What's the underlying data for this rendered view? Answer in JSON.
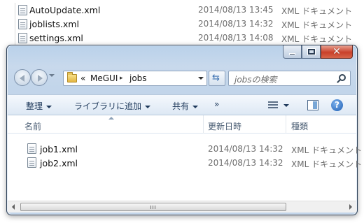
{
  "background_list": [
    {
      "name": "AutoUpdate.xml",
      "date": "2014/08/13 13:45",
      "type": "XML ドキュメント"
    },
    {
      "name": "joblists.xml",
      "date": "2014/08/13 14:32",
      "type": "XML ドキュメント"
    },
    {
      "name": "settings.xml",
      "date": "2014/08/13 14:08",
      "type": "XML ドキュメント"
    }
  ],
  "window": {
    "caption_buttons": {
      "minimize": "minimize-icon",
      "maximize": "maximize-icon",
      "close": "✕"
    },
    "address": {
      "prefix": "«",
      "crumbs": [
        "MeGUI",
        "jobs"
      ],
      "separator": "▸"
    },
    "search": {
      "placeholder": "jobsの検索"
    },
    "commands": [
      {
        "label": "整理"
      },
      {
        "label": "ライブラリに追加"
      },
      {
        "label": "共有"
      }
    ],
    "more": "»",
    "help": "?",
    "columns": [
      "名前",
      "更新日時",
      "種類"
    ],
    "files": [
      {
        "name": "job1.xml",
        "date": "2014/08/13 14:32",
        "type": "XML ドキュメント"
      },
      {
        "name": "job2.xml",
        "date": "2014/08/13 14:32",
        "type": "XML ドキュメント"
      }
    ]
  },
  "colors": {
    "title_glass": "#c2d5ea",
    "close_red": "#c9402a",
    "command_text": "#1e395b"
  }
}
